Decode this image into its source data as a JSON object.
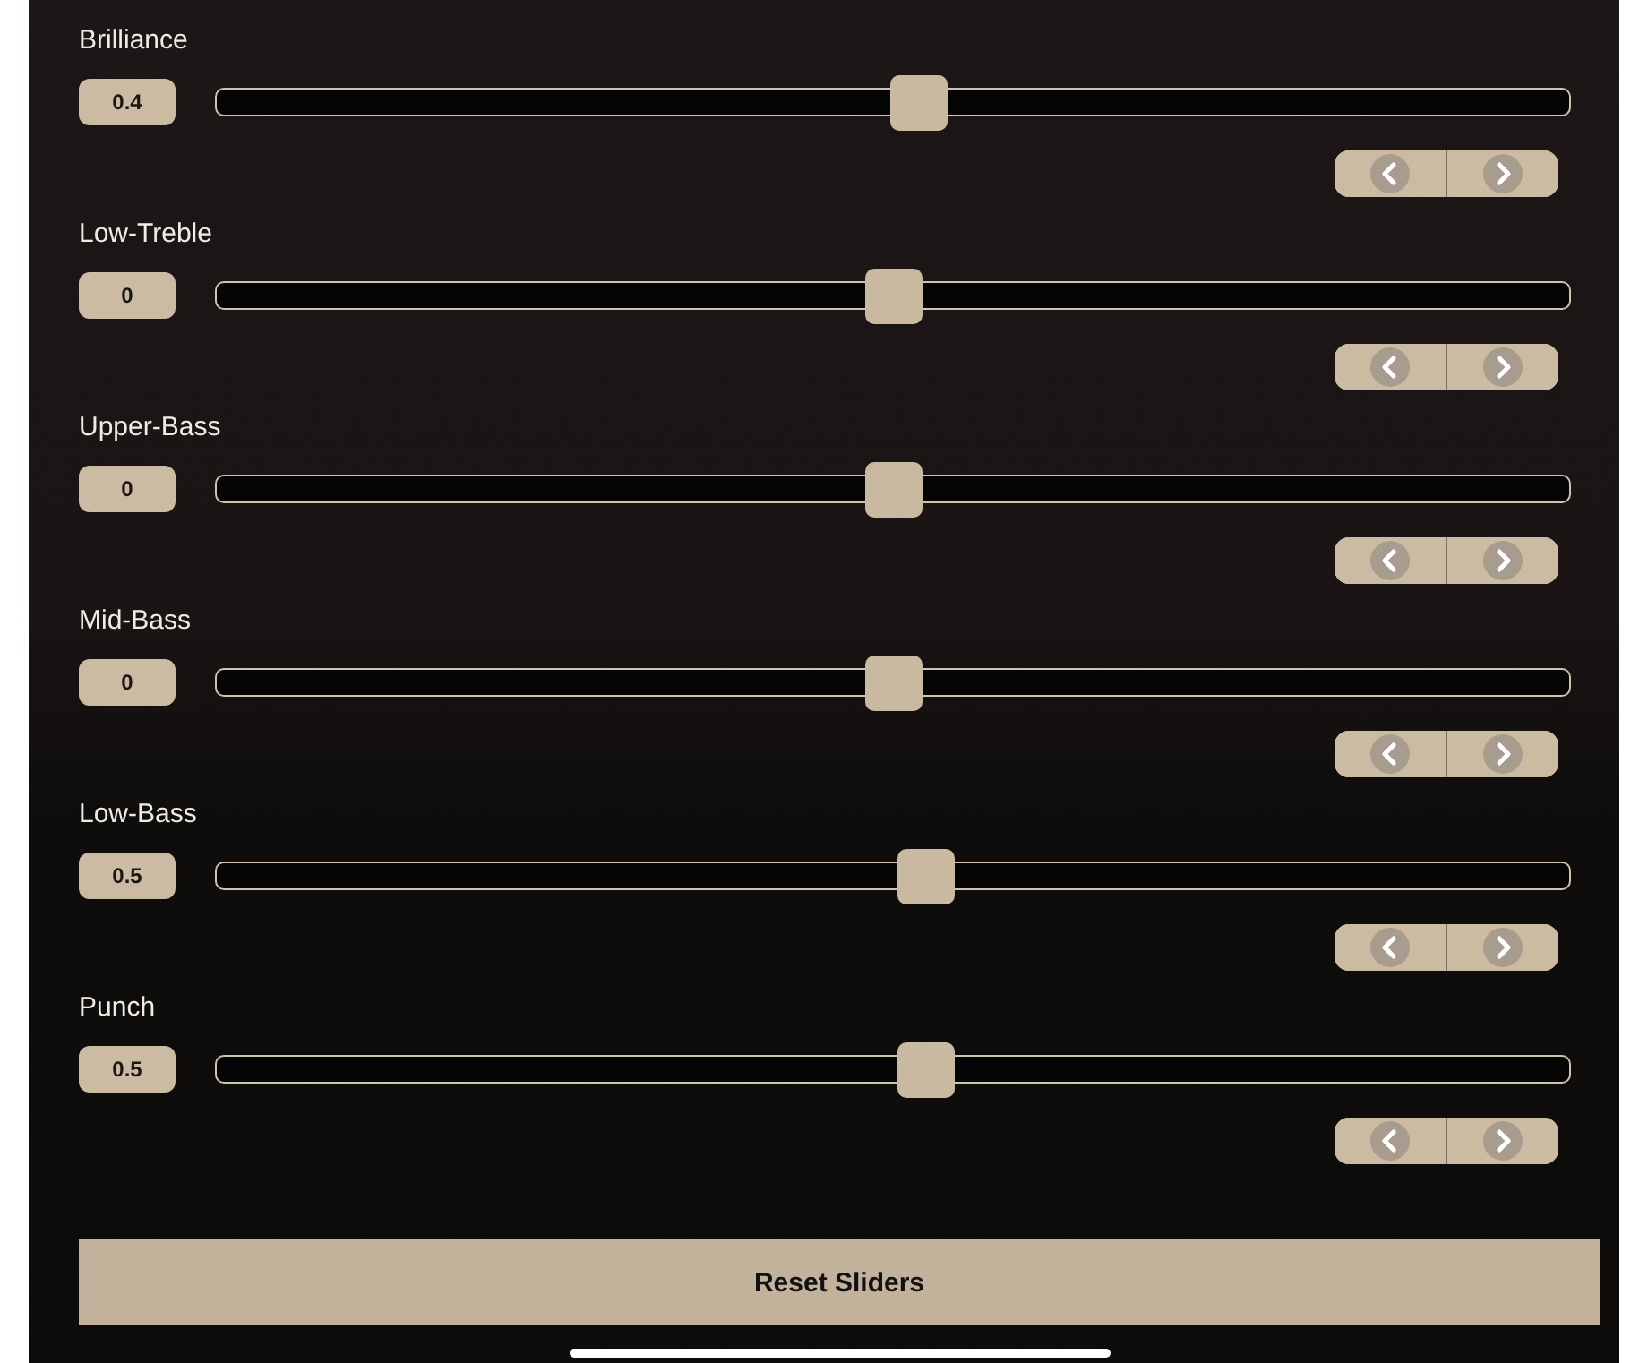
{
  "sliders": [
    {
      "label": "Brilliance",
      "value": "0.4",
      "level": 0.52
    },
    {
      "label": "Low-Treble",
      "value": "0",
      "level": 0.5
    },
    {
      "label": "Upper-Bass",
      "value": "0",
      "level": 0.5
    },
    {
      "label": "Mid-Bass",
      "value": "0",
      "level": 0.5
    },
    {
      "label": "Low-Bass",
      "value": "0.5",
      "level": 0.525
    },
    {
      "label": "Punch",
      "value": "0.5",
      "level": 0.525
    }
  ],
  "reset_button": {
    "label": "Reset Sliders"
  }
}
